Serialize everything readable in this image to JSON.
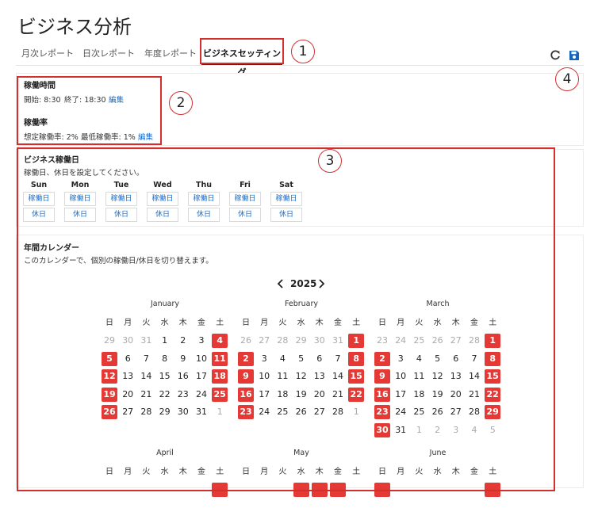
{
  "page": {
    "title": "ビジネス分析"
  },
  "tabs": [
    {
      "label": "月次レポート"
    },
    {
      "label": "日次レポート"
    },
    {
      "label": "年度レポート"
    },
    {
      "label": "ビジネスセッティング"
    }
  ],
  "toolbar": {
    "refresh_icon": "refresh-icon",
    "save_icon": "save-icon",
    "accent": "#1565c0"
  },
  "operating_hours": {
    "title": "稼働時間",
    "start_label": "開始: 8:30",
    "end_label": "終了: 18:30",
    "edit_label": "編集"
  },
  "operating_rate": {
    "title": "稼働率",
    "expected_label": "想定稼働率: 2%",
    "min_label": "最低稼働率: 1%",
    "edit_label": "編集"
  },
  "business_days": {
    "title": "ビジネス稼働日",
    "description": "稼働日、休日を設定してください。",
    "days": [
      {
        "name": "Sun",
        "work": "稼働日",
        "off": "休日"
      },
      {
        "name": "Mon",
        "work": "稼働日",
        "off": "休日"
      },
      {
        "name": "Tue",
        "work": "稼働日",
        "off": "休日"
      },
      {
        "name": "Wed",
        "work": "稼働日",
        "off": "休日"
      },
      {
        "name": "Thu",
        "work": "稼働日",
        "off": "休日"
      },
      {
        "name": "Fri",
        "work": "稼働日",
        "off": "休日"
      },
      {
        "name": "Sat",
        "work": "稼働日",
        "off": "休日"
      }
    ]
  },
  "calendar": {
    "title": "年間カレンダー",
    "description": "このカレンダーで、個別の稼働日/休日を切り替えます。",
    "year": "2025",
    "prev_icon": "chevron-left-icon",
    "next_icon": "chevron-right-icon",
    "holiday_color": "#e53935",
    "weekdays": [
      "日",
      "月",
      "火",
      "水",
      "木",
      "金",
      "土"
    ],
    "months": [
      {
        "name": "January",
        "weeks": [
          [
            {
              "d": "29",
              "o": 1
            },
            {
              "d": "30",
              "o": 1
            },
            {
              "d": "31",
              "o": 1
            },
            {
              "d": "1"
            },
            {
              "d": "2"
            },
            {
              "d": "3"
            },
            {
              "d": "4",
              "h": 1
            }
          ],
          [
            {
              "d": "5",
              "h": 1
            },
            {
              "d": "6"
            },
            {
              "d": "7"
            },
            {
              "d": "8"
            },
            {
              "d": "9"
            },
            {
              "d": "10"
            },
            {
              "d": "11",
              "h": 1
            }
          ],
          [
            {
              "d": "12",
              "h": 1
            },
            {
              "d": "13"
            },
            {
              "d": "14"
            },
            {
              "d": "15"
            },
            {
              "d": "16"
            },
            {
              "d": "17"
            },
            {
              "d": "18",
              "h": 1
            }
          ],
          [
            {
              "d": "19",
              "h": 1
            },
            {
              "d": "20"
            },
            {
              "d": "21"
            },
            {
              "d": "22"
            },
            {
              "d": "23"
            },
            {
              "d": "24"
            },
            {
              "d": "25",
              "h": 1
            }
          ],
          [
            {
              "d": "26",
              "h": 1
            },
            {
              "d": "27"
            },
            {
              "d": "28"
            },
            {
              "d": "29"
            },
            {
              "d": "30"
            },
            {
              "d": "31"
            },
            {
              "d": "1",
              "o": 1
            }
          ]
        ]
      },
      {
        "name": "February",
        "weeks": [
          [
            {
              "d": "26",
              "o": 1
            },
            {
              "d": "27",
              "o": 1
            },
            {
              "d": "28",
              "o": 1
            },
            {
              "d": "29",
              "o": 1
            },
            {
              "d": "30",
              "o": 1
            },
            {
              "d": "31",
              "o": 1
            },
            {
              "d": "1",
              "h": 1
            }
          ],
          [
            {
              "d": "2",
              "h": 1
            },
            {
              "d": "3"
            },
            {
              "d": "4"
            },
            {
              "d": "5"
            },
            {
              "d": "6"
            },
            {
              "d": "7"
            },
            {
              "d": "8",
              "h": 1
            }
          ],
          [
            {
              "d": "9",
              "h": 1
            },
            {
              "d": "10"
            },
            {
              "d": "11"
            },
            {
              "d": "12"
            },
            {
              "d": "13"
            },
            {
              "d": "14"
            },
            {
              "d": "15",
              "h": 1
            }
          ],
          [
            {
              "d": "16",
              "h": 1
            },
            {
              "d": "17"
            },
            {
              "d": "18"
            },
            {
              "d": "19"
            },
            {
              "d": "20"
            },
            {
              "d": "21"
            },
            {
              "d": "22",
              "h": 1
            }
          ],
          [
            {
              "d": "23",
              "h": 1
            },
            {
              "d": "24"
            },
            {
              "d": "25"
            },
            {
              "d": "26"
            },
            {
              "d": "27"
            },
            {
              "d": "28"
            },
            {
              "d": "1",
              "o": 1
            }
          ]
        ]
      },
      {
        "name": "March",
        "weeks": [
          [
            {
              "d": "23",
              "o": 1
            },
            {
              "d": "24",
              "o": 1
            },
            {
              "d": "25",
              "o": 1
            },
            {
              "d": "26",
              "o": 1
            },
            {
              "d": "27",
              "o": 1
            },
            {
              "d": "28",
              "o": 1
            },
            {
              "d": "1",
              "h": 1
            }
          ],
          [
            {
              "d": "2",
              "h": 1
            },
            {
              "d": "3"
            },
            {
              "d": "4"
            },
            {
              "d": "5"
            },
            {
              "d": "6"
            },
            {
              "d": "7"
            },
            {
              "d": "8",
              "h": 1
            }
          ],
          [
            {
              "d": "9",
              "h": 1
            },
            {
              "d": "10"
            },
            {
              "d": "11"
            },
            {
              "d": "12"
            },
            {
              "d": "13"
            },
            {
              "d": "14"
            },
            {
              "d": "15",
              "h": 1
            }
          ],
          [
            {
              "d": "16",
              "h": 1
            },
            {
              "d": "17"
            },
            {
              "d": "18"
            },
            {
              "d": "19"
            },
            {
              "d": "20"
            },
            {
              "d": "21"
            },
            {
              "d": "22",
              "h": 1
            }
          ],
          [
            {
              "d": "23",
              "h": 1
            },
            {
              "d": "24"
            },
            {
              "d": "25"
            },
            {
              "d": "26"
            },
            {
              "d": "27"
            },
            {
              "d": "28"
            },
            {
              "d": "29",
              "h": 1
            }
          ],
          [
            {
              "d": "30",
              "h": 1
            },
            {
              "d": "31"
            },
            {
              "d": "1",
              "o": 1
            },
            {
              "d": "2",
              "o": 1
            },
            {
              "d": "3",
              "o": 1
            },
            {
              "d": "4",
              "o": 1
            },
            {
              "d": "5",
              "o": 1
            }
          ]
        ]
      },
      {
        "name": "April",
        "weeks": [
          [
            {
              "d": ""
            },
            {
              "d": ""
            },
            {
              "d": ""
            },
            {
              "d": ""
            },
            {
              "d": ""
            },
            {
              "d": ""
            },
            {
              "d": "",
              "h": 1
            }
          ]
        ]
      },
      {
        "name": "May",
        "weeks": [
          [
            {
              "d": ""
            },
            {
              "d": ""
            },
            {
              "d": ""
            },
            {
              "d": "",
              "h": 1
            },
            {
              "d": "",
              "h": 1
            },
            {
              "d": "",
              "h": 1
            },
            {
              "d": ""
            }
          ]
        ]
      },
      {
        "name": "June",
        "weeks": [
          [
            {
              "d": "",
              "h": 1
            },
            {
              "d": ""
            },
            {
              "d": ""
            },
            {
              "d": ""
            },
            {
              "d": ""
            },
            {
              "d": ""
            },
            {
              "d": "",
              "h": 1
            }
          ]
        ]
      }
    ]
  },
  "annotations": [
    "1",
    "2",
    "3",
    "4"
  ]
}
